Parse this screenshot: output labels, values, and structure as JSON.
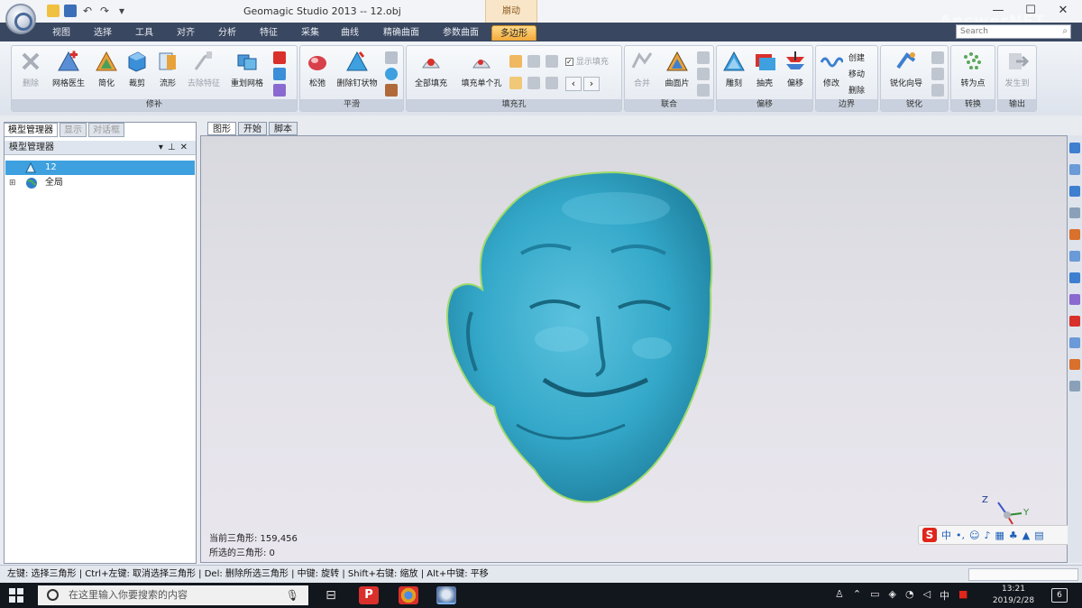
{
  "window": {
    "title": "Geomagic Studio 2013 -- 12.obj",
    "context_title": "崩动",
    "watermark": "AnswerNET"
  },
  "tabs": [
    {
      "label": "视图"
    },
    {
      "label": "选择"
    },
    {
      "label": "工具"
    },
    {
      "label": "对齐"
    },
    {
      "label": "分析"
    },
    {
      "label": "特征"
    },
    {
      "label": "采集"
    },
    {
      "label": "曲线"
    },
    {
      "label": "精确曲面"
    },
    {
      "label": "参数曲面"
    },
    {
      "label": "多边形"
    }
  ],
  "active_tab": "多边形",
  "search": {
    "placeholder": "Search"
  },
  "ribbon": {
    "groups": [
      {
        "label": "修补",
        "buttons": [
          "删除",
          "网格医生",
          "简化",
          "裁剪",
          "流形",
          "去除特征",
          "重划网格"
        ]
      },
      {
        "label": "平滑",
        "buttons": [
          "松弛",
          "删除钉状物"
        ]
      },
      {
        "label": "填充孔",
        "buttons": [
          "全部填充",
          "填充单个孔"
        ],
        "checkbox": "显示填充"
      },
      {
        "label": "联合",
        "buttons": [
          "合并",
          "曲面片"
        ]
      },
      {
        "label": "偏移",
        "buttons": [
          "雕刻",
          "抽壳",
          "偏移"
        ]
      },
      {
        "label": "边界",
        "buttons": [
          "修改"
        ],
        "small": [
          "创建",
          "移动",
          "删除"
        ]
      },
      {
        "label": "锐化",
        "buttons": [
          "锐化向导"
        ]
      },
      {
        "label": "转换",
        "buttons": [
          "转为点"
        ]
      },
      {
        "label": "输出",
        "buttons": [
          "发生到"
        ]
      }
    ]
  },
  "panel_tabs": [
    {
      "label": "模型管理器",
      "active": true
    },
    {
      "label": "显示",
      "active": false
    },
    {
      "label": "对话框",
      "active": false
    }
  ],
  "panel": {
    "title": "模型管理器",
    "items": [
      {
        "label": "12",
        "selected": true
      },
      {
        "label": "全局",
        "selected": false
      }
    ]
  },
  "view_tabs": [
    {
      "label": "图形",
      "active": true
    },
    {
      "label": "开始",
      "active": false
    },
    {
      "label": "脚本",
      "active": false
    }
  ],
  "viewport": {
    "current_triangles": "当前三角形: 159,456",
    "selected_triangles": "所选的三角形: 0",
    "model_color": "#34a8c9",
    "axis_z": "Z",
    "axis_y": "Y"
  },
  "statusbar": {
    "hint": "左键: 选择三角形 | Ctrl+左键: 取消选择三角形 | Del: 删除所选三角形 | 中键: 旋转 | Shift+右键: 缩放 | Alt+中键: 平移"
  },
  "ime": {
    "logo": "S",
    "mode": "中"
  },
  "taskbar": {
    "search_placeholder": "在这里输入你要搜索的内容",
    "tray_lang": "中",
    "time": "13:21",
    "date": "2019/2/28",
    "notifications": "6"
  },
  "colors": {
    "accent_tab": "#f2a93a",
    "selection": "#3ea0df",
    "tabbar": "#3a4760"
  }
}
